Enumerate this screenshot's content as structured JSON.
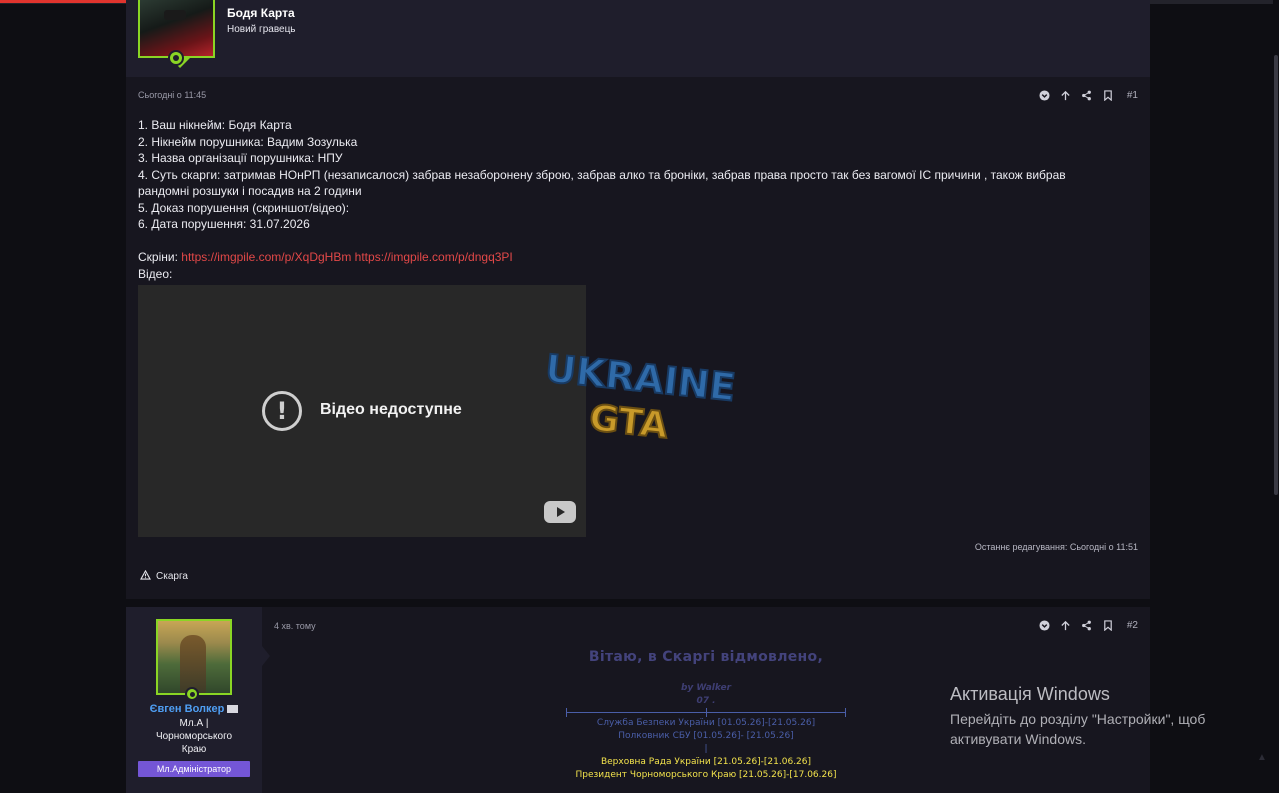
{
  "page": {
    "accent": "#e0342e",
    "online_color": "#8ad524",
    "link_color": "#e24848"
  },
  "post1": {
    "author_name": "Бодя Карта",
    "author_role": "Новий гравець",
    "date": "Сьогодні о 11:45",
    "post_number": "#1",
    "lines": [
      "1. Ваш нікнейм: Бодя Карта",
      "2. Нікнейм порушника: Вадим Зозулька",
      "3. Назва організації порушника: НПУ",
      "4. Суть скарги: затримав НОнРП (незаписалося) забрав незаборонену зброю, забрав алко та броніки, забрав права просто так без вагомої ІС причини , також вибрав",
      "рандомні розшуки і посадив на 2 години",
      "5. Доказ порушення (скриншот/відео):",
      "6. Дата порушення: 31.07.2026"
    ],
    "screens_label": "Скріни:",
    "link1": "https://imgpile.com/p/XqDgHBm",
    "link2": "https://imgpile.com/p/dngq3PI",
    "video_label": "Відео:",
    "video_unavailable": "Відео недоступне",
    "logo_line1": "UKRAINE",
    "logo_line2": "GTA",
    "last_edited": "Останнє редагування: Сьогодні о 11:51",
    "report_label": "Скарга"
  },
  "post2": {
    "author_name": "Євген Волкер",
    "author_title_lines": [
      "Мл.А |",
      "Чорноморського",
      "Краю"
    ],
    "badge": "Мл.Адміністратор",
    "date": "4 хв. тому",
    "post_number": "#2",
    "greeting": "Вітаю, в Скаргі відмовлено,",
    "sig_by": "by Walker",
    "sig_num": "07 .",
    "sig_roles_blue": [
      "Служба Безпеки України [01.05.26]-[21.05.26]",
      "Полковник СБУ [01.05.26]- [21.05.26]"
    ],
    "sig_pipe": "|",
    "sig_roles_yellow": [
      "Верховна Рада України [21.05.26]-[21.06.26]",
      "Президент Чорноморського Краю [21.05.26]-[17.06.26]"
    ]
  },
  "windows": {
    "title": "Активація Windows",
    "line1": "Перейдіть до розділу \"Настройки\", щоб",
    "line2": "активувати Windows."
  },
  "icons": [
    "chevron-down-circle-icon",
    "arrow-up-icon",
    "share-icon",
    "bookmark-icon",
    "warning-icon",
    "envelope-icon",
    "user-dot-icon",
    "youtube-icon",
    "exclamation-icon"
  ]
}
